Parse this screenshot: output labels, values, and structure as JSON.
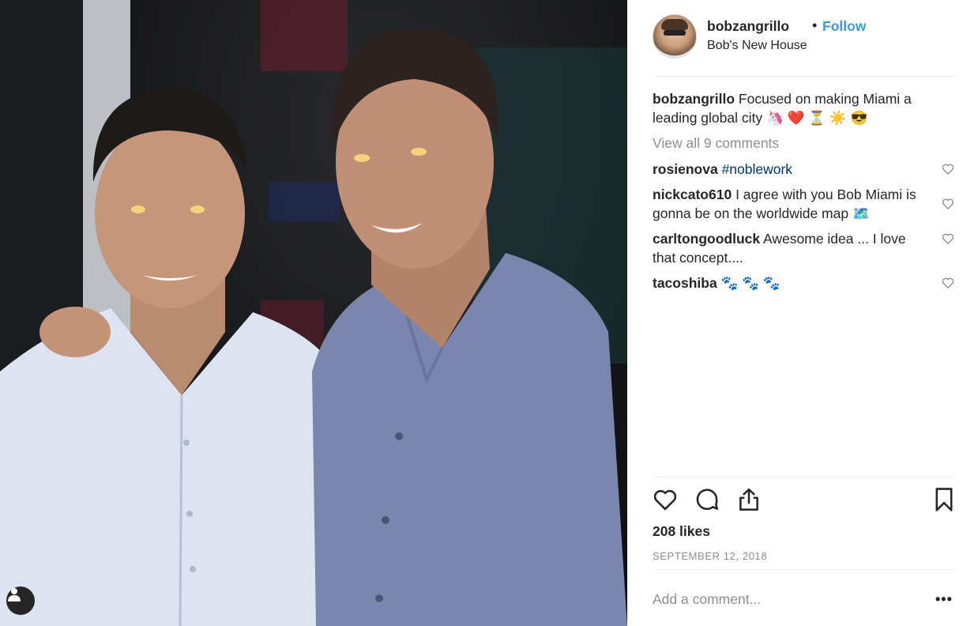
{
  "post": {
    "photo_icon": "person-tag-icon",
    "header": {
      "username": "bobzangrillo",
      "separator": "•",
      "follow_label": "Follow",
      "location": "Bob's New House"
    },
    "caption": {
      "username": "bobzangrillo",
      "text": "Focused on making Miami a leading global city 🦄 ❤️ ⏳ ☀️ 😎"
    },
    "view_all_label": "View all 9 comments",
    "comments": [
      {
        "username": "rosienova",
        "text": "#noblework"
      },
      {
        "username": "nickcato610",
        "text": "I agree with you Bob Miami is gonna be on the worldwide map 🗺️"
      },
      {
        "username": "carltongoodluck",
        "text": "Awesome idea ... I love that concept...."
      },
      {
        "username": "tacoshiba",
        "text": "🐾 🐾 🐾"
      }
    ],
    "actions": {
      "like_icon": "heart-icon",
      "comment_icon": "comment-icon",
      "share_icon": "share-icon",
      "save_icon": "bookmark-icon"
    },
    "likes": "208 likes",
    "date": "SEPTEMBER 12, 2018",
    "add_comment_placeholder": "Add a comment...",
    "more_label": "•••"
  },
  "colors": {
    "link_blue": "#3897f0",
    "muted_gray": "#8e8e8e",
    "text": "#262626",
    "divider": "#efefef"
  }
}
